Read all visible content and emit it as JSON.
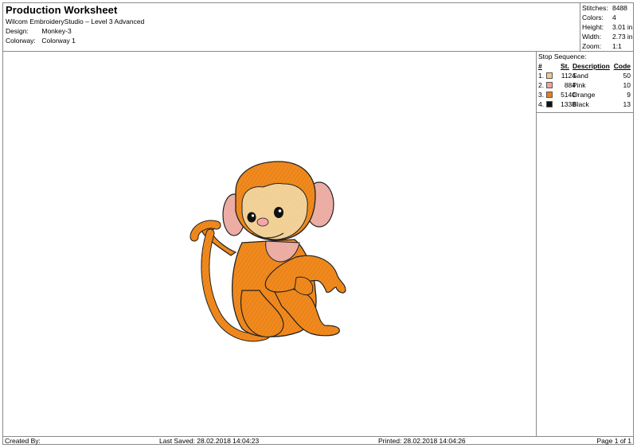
{
  "header": {
    "title": "Production Worksheet",
    "subtitle": "Wilcom EmbroideryStudio – Level 3 Advanced",
    "design_label": "Design:",
    "design_value": "Monkey-3",
    "colorway_label": "Colorway:",
    "colorway_value": "Colorway 1"
  },
  "stats": {
    "stitches_label": "Stitches:",
    "stitches_value": "8488",
    "colors_label": "Colors:",
    "colors_value": "4",
    "height_label": "Height:",
    "height_value": "3.01 in",
    "width_label": "Width:",
    "width_value": "2.73 in",
    "zoom_label": "Zoom:",
    "zoom_value": "1:1"
  },
  "stop_sequence": {
    "title": "Stop Sequence:",
    "headers": {
      "num": "#",
      "st": "St.",
      "description": "Description",
      "code": "Code"
    },
    "rows": [
      {
        "num": "1.",
        "st": "1124",
        "description": "Sand",
        "code": "50",
        "color": "#f5c98d"
      },
      {
        "num": "2.",
        "st": "884",
        "description": "Pink",
        "code": "10",
        "color": "#f2a3a0"
      },
      {
        "num": "3.",
        "st": "5140",
        "description": "Orange",
        "code": "9",
        "color": "#f07c16"
      },
      {
        "num": "4.",
        "st": "1338",
        "description": "Black",
        "code": "13",
        "color": "#111111"
      }
    ]
  },
  "footer": {
    "created_by": "Created By:",
    "last_saved": "Last Saved: 28.02.2018 14:04:23",
    "printed": "Printed: 28.02.2018 14:04:26",
    "page": "Page 1 of 1"
  },
  "colors": {
    "orange": "#f08a1e",
    "orange_dark": "#d96c10",
    "sand": "#f3d39a",
    "pink": "#f0b2a8",
    "pink_ear": "#e9aaa4",
    "black": "#111111",
    "nose": "#f5a6a8"
  }
}
